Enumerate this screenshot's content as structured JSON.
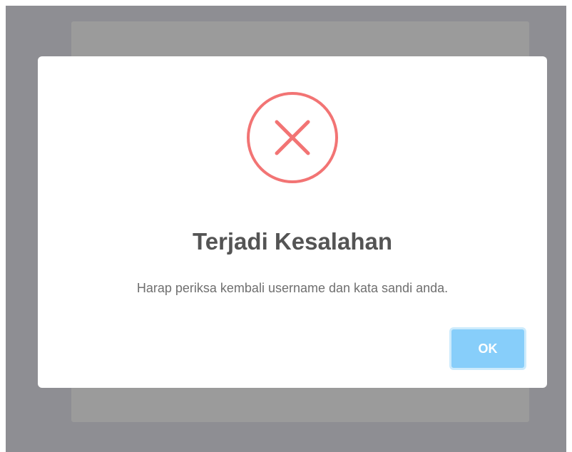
{
  "dialog": {
    "icon": "error-x-icon",
    "title": "Terjadi Kesalahan",
    "message": "Harap periksa kembali username dan kata sandi anda.",
    "ok_label": "OK"
  },
  "colors": {
    "overlay": "#8e8e93",
    "backdrop_card": "#9b9b9b",
    "modal_background": "#ffffff",
    "error_accent": "#f27474",
    "title_text": "#545454",
    "message_text": "#6f6f6f",
    "button_background": "#87cefa",
    "button_text": "#ffffff"
  }
}
